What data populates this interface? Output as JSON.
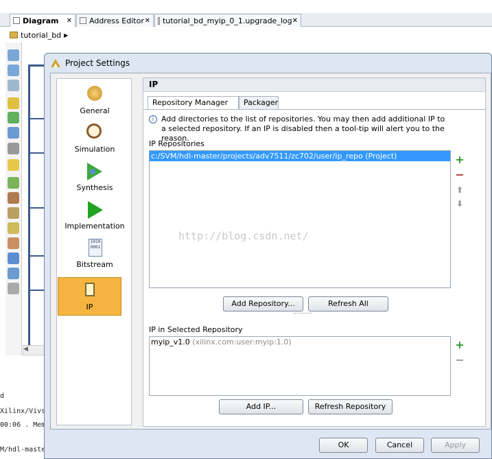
{
  "tabs": [
    {
      "label": "Diagram",
      "close": "✕"
    },
    {
      "label": "Address Editor",
      "close": "✕"
    },
    {
      "label": "tutorial_bd_myip_0_1.upgrade_log",
      "close": "✕"
    }
  ],
  "breadcrumb": {
    "item": "tutorial_bd",
    "arrow": "▶"
  },
  "console_lines": [
    "d",
    "Xilinx/Vivs",
    "00:06 . Mem",
    "M/hdl-maste"
  ],
  "dialog": {
    "title": "Project Settings",
    "nav": [
      {
        "label": "General",
        "icon": "gear-icon"
      },
      {
        "label": "Simulation",
        "icon": "waveform-magnifier-icon"
      },
      {
        "label": "Synthesis",
        "icon": "synthesis-icon"
      },
      {
        "label": "Implementation",
        "icon": "play-arrow-icon"
      },
      {
        "label": "Bitstream",
        "icon": "binary-file-icon"
      },
      {
        "label": "IP",
        "icon": "chip-icon",
        "selected": true
      }
    ],
    "section_title": "IP",
    "subtabs": [
      "Repository Manager",
      "Packager"
    ],
    "info_text": "Add directories to the list of repositories. You may then add additional IP to a selected repository. If an IP is disabled then a tool-tip will alert you to the reason.",
    "repos_label": "IP Repositories",
    "repos": [
      "c:/SVM/hdl-master/projects/adv7511/zc702/user/ip_repo (Project)"
    ],
    "add_repo": "Add Repository...",
    "refresh_all": "Refresh All",
    "splitter": "..........",
    "selected_label": "IP in Selected Repository",
    "ip_items": [
      {
        "name": "myip_v1.0",
        "detail": "(xilinx.com:user:myip:1.0)"
      }
    ],
    "add_ip": "Add IP...",
    "refresh_repo": "Refresh Repository",
    "ok": "OK",
    "cancel": "Cancel",
    "apply": "Apply"
  },
  "watermark": "http://blog.csdn.net/",
  "colors": {
    "selected_row": "#3399ff",
    "selected_nav": "#f4b43f",
    "add_green": "#2e9a2e",
    "remove_red": "#b03a2e"
  }
}
